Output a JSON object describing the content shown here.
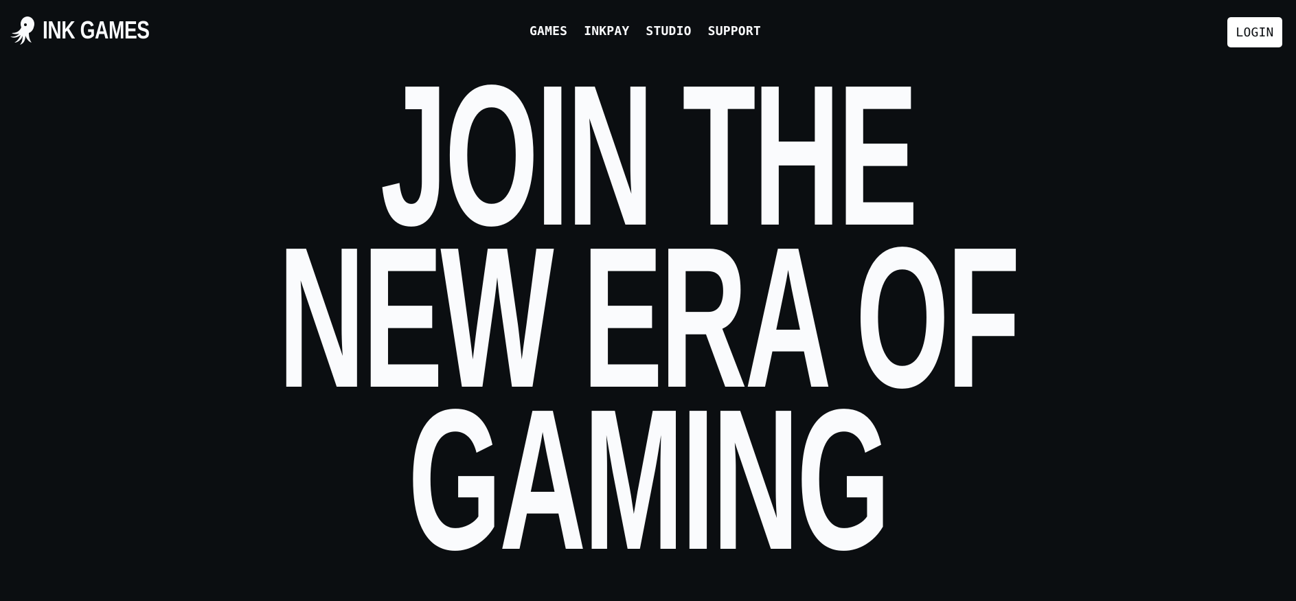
{
  "brand": {
    "name": "INK GAMES",
    "logo_icon": "octopus-icon"
  },
  "nav": {
    "items": [
      {
        "label": "GAMES"
      },
      {
        "label": "INKPAY"
      },
      {
        "label": "STUDIO"
      },
      {
        "label": "SUPPORT"
      }
    ]
  },
  "header": {
    "login_label": "LOGIN"
  },
  "hero": {
    "lines": [
      "JOIN THE",
      "NEW ERA OF",
      "GAMING"
    ]
  },
  "colors": {
    "background": "#0b0e11",
    "text": "#fafbfd",
    "button_bg": "#ffffff",
    "button_text": "#0b0e11"
  }
}
